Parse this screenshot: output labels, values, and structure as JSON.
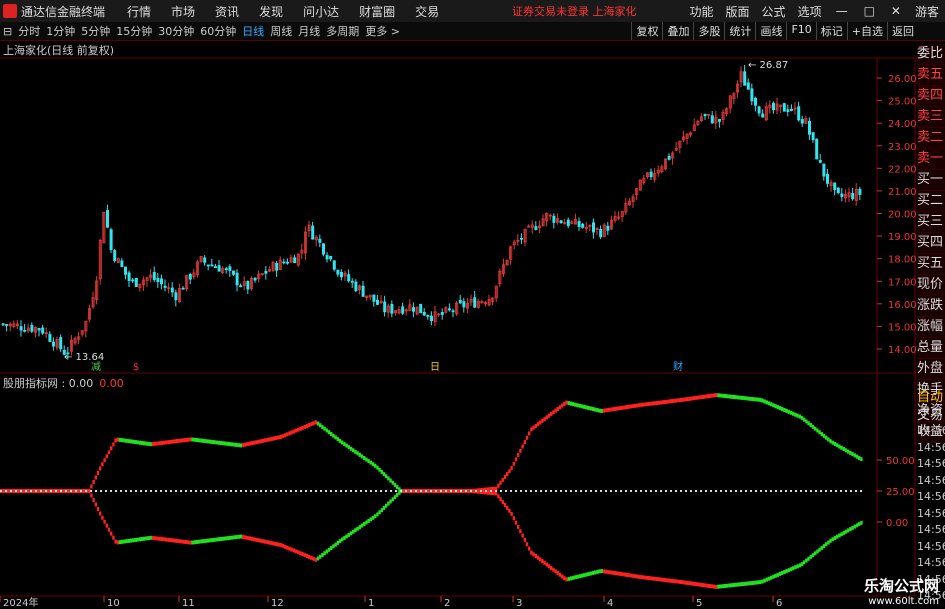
{
  "menubar": {
    "app_title": "通达信金融终端",
    "items": [
      "行情",
      "市场",
      "资讯",
      "发现",
      "问小达",
      "财富圈",
      "交易"
    ],
    "status": "证券交易未登录  上海家化",
    "right_items": [
      "功能",
      "版面",
      "公式",
      "选项"
    ],
    "user": "游客"
  },
  "periods": [
    "分时",
    "1分钟",
    "5分钟",
    "15分钟",
    "30分钟",
    "60分钟",
    "日线",
    "周线",
    "月线",
    "多周期",
    "更多 >"
  ],
  "toolbar": [
    "复权",
    "叠加",
    "多股",
    "统计",
    "画线",
    "F10",
    "标记",
    "+自选",
    "返回"
  ],
  "chart": {
    "title": "上海家化(日线 前复权)",
    "high_label": "26.87",
    "low_label": "13.64",
    "price_axis": [
      "26.00",
      "25.00",
      "24.00",
      "23.00",
      "22.00",
      "21.00",
      "20.00",
      "19.00",
      "18.00",
      "17.00",
      "16.00",
      "15.00",
      "14.00"
    ],
    "markers": [
      "减",
      "$",
      "日",
      "财"
    ],
    "x_axis": [
      "2024年",
      "10",
      "11",
      "12",
      "1",
      "2",
      "3",
      "4",
      "5",
      "6"
    ],
    "colors": {
      "up": "#e23a3a",
      "down": "#2ee6ee",
      "osc_up": "#ff2020",
      "osc_down": "#20e020"
    }
  },
  "indicator": {
    "name": "股朋指标网 : 0.00",
    "value": "0.00",
    "axis": [
      "50.00",
      "25.00",
      "0.00"
    ]
  },
  "side_panel": {
    "items": [
      "委比",
      "卖五",
      "卖四",
      "卖三",
      "卖二",
      "卖一",
      "买一",
      "买二",
      "买三",
      "买四",
      "买五",
      "现价",
      "涨跌",
      "涨幅",
      "总量",
      "外盘",
      "换手",
      "净资",
      "收益"
    ],
    "auto": "自动",
    "trade": "交易",
    "times": [
      "14:56",
      "14:56",
      "14:56",
      "14:56",
      "14:56",
      "14:56",
      "14:56",
      "14:56",
      "14:56",
      "14:56",
      "14:56",
      "14:56"
    ]
  },
  "watermark": {
    "title": "乐淘公式网",
    "url": "www.60lt.com"
  }
}
